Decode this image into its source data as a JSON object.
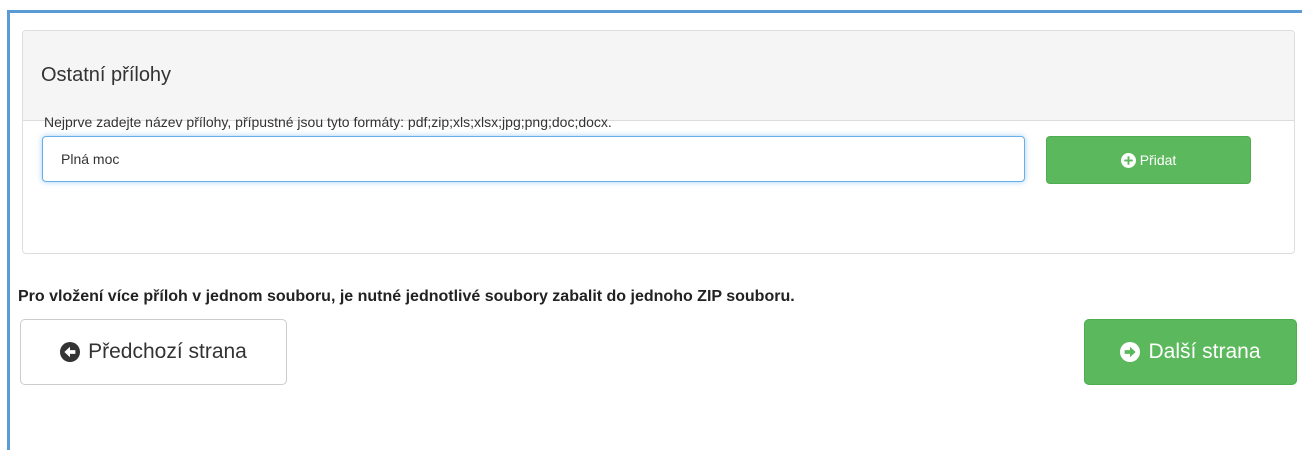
{
  "panel": {
    "title": "Ostatní přílohy",
    "help_text": "Nejprve zadejte název přílohy, přípustné jsou tyto formáty: pdf;zip;xls;xlsx;jpg;png;doc;docx.",
    "input_value": "Plná moc",
    "add_button_label": "Přidat",
    "add_icon": "plus-circle-icon"
  },
  "note": "Pro vložení více příloh v jednom souboru, je nutné jednotlivé soubory zabalit do jednoho ZIP souboru.",
  "navigation": {
    "prev_label": "Předchozí strana",
    "prev_icon": "arrow-left-circle-icon",
    "next_label": "Další strana",
    "next_icon": "arrow-right-circle-icon"
  },
  "colors": {
    "success": "#5cb85c",
    "focus_border": "#66afe9",
    "frame_border": "#5b9bd5",
    "panel_heading_bg": "#f5f5f5"
  }
}
